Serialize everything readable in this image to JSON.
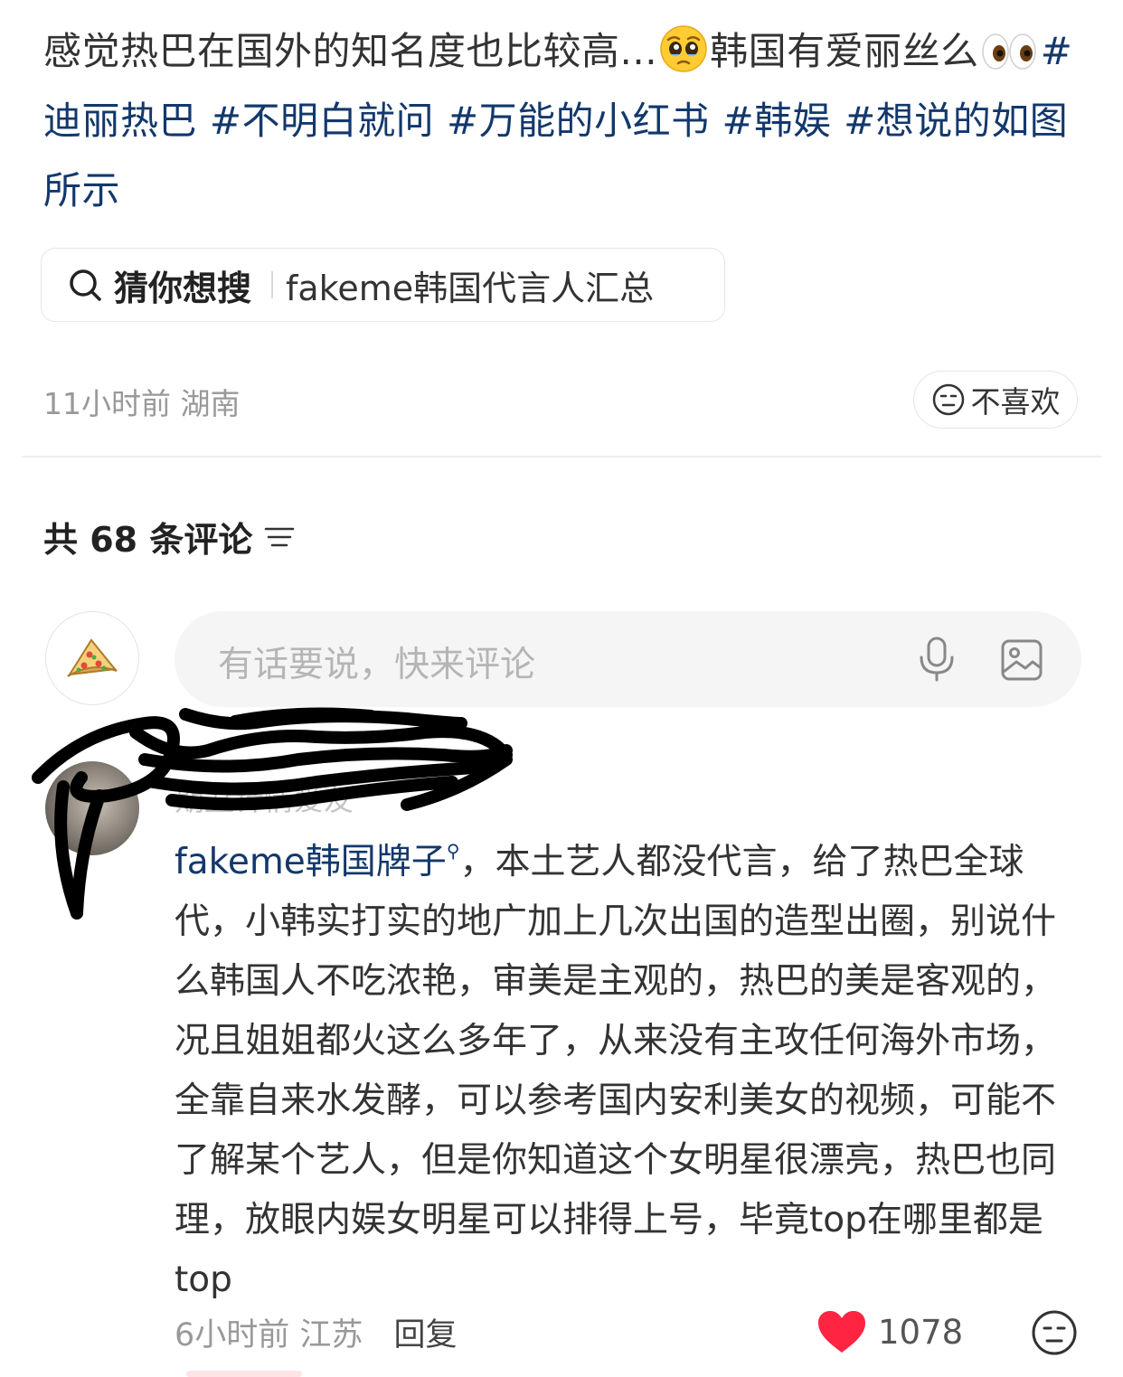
{
  "post": {
    "text_before_face": "感觉热巴在国外的知名度也比较高...",
    "text_after_face": "韩国有爱丽丝么",
    "hashtags": [
      "#迪丽热巴",
      "#不明白就问",
      "#万能的小红书",
      "#韩娱",
      "#想说的如图所示"
    ],
    "face_emoji_icon": "pleading-face-icon",
    "eyes_emoji_icon": "eyes-icon"
  },
  "guess_search": {
    "title": "猜你想搜",
    "query": "fakeme韩国代言人汇总"
  },
  "post_meta": {
    "time": "11小时前",
    "location": "湖南"
  },
  "dislike_button": {
    "label": "不喜欢"
  },
  "comments_header": {
    "count_label": "共 68 条评论"
  },
  "comment_input": {
    "placeholder": "有话要说，快来评论"
  },
  "comment": {
    "author": "期丑针情爱友",
    "link_text": "fakeme韩国牌子",
    "link_suffix": "，",
    "body": "本土艺人都没代言，给了热巴全球代，小韩实打实的地广加上几次出国的造型出圈，别说什么韩国人不吃浓艳，审美是主观的，热巴的美是客观的，况且姐姐都火这么多年了，从来没有主攻任何海外市场，全靠自来水发酵，可以参考国内安利美女的视频，可能不了解某个艺人，但是你知道这个女明星很漂亮，热巴也同理，放眼内娱女明星可以排得上号，毕竟top在哪里都是top",
    "time": "6小时前",
    "location": "江苏",
    "reply_label": "回复",
    "like_count": "1078"
  },
  "colors": {
    "hashtag": "#13386c",
    "like_heart": "#ff2442",
    "muted_text": "#999999",
    "input_bg": "#f5f5f5"
  }
}
